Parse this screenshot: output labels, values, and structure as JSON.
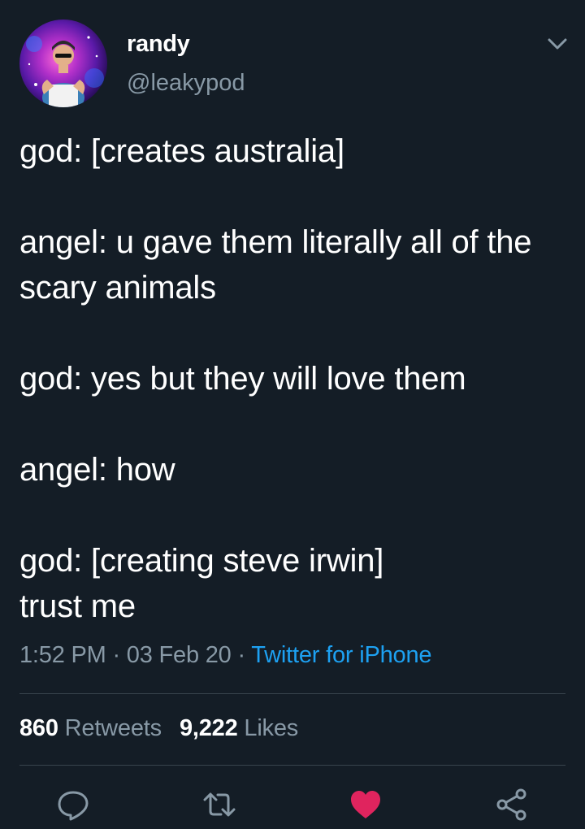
{
  "user": {
    "display_name": "randy",
    "handle": "@leakypod"
  },
  "tweet": {
    "text": "god: [creates australia]\n\nangel: u gave them literally all of the scary animals\n\ngod: yes but they will love them\n\nangel: how\n\ngod: [creating steve irwin]\ntrust me"
  },
  "meta": {
    "time": "1:52 PM",
    "separator": " · ",
    "date": "03 Feb 20",
    "source": "Twitter for iPhone"
  },
  "stats": {
    "retweets_count": "860",
    "retweets_label": "Retweets",
    "likes_count": "9,222",
    "likes_label": "Likes"
  },
  "actions": {
    "reply_icon": "reply-icon",
    "retweet_icon": "retweet-icon",
    "like_icon": "heart-icon",
    "share_icon": "share-icon",
    "liked": true
  },
  "colors": {
    "background": "#141d26",
    "secondary_text": "#8899a6",
    "link": "#1da1f2",
    "like": "#e0245e",
    "divider": "#38444d"
  }
}
